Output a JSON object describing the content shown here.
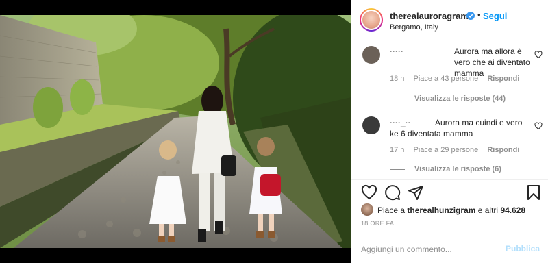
{
  "header": {
    "username": "therealauroragram",
    "follow_label": "Segui",
    "separator": "•",
    "location": "Bergamo, Italy"
  },
  "comments": [
    {
      "username": "·····",
      "text": "Aurora ma allora è vero che ai diventato mamma",
      "time": "18 h",
      "likes": "Piace a 43 persone",
      "reply_label": "Rispondi",
      "view_replies": "Visualizza le risposte (44)"
    },
    {
      "username": "····_··",
      "text": "Aurora ma cuindi e vero ke 6 diventata mamma",
      "time": "17 h",
      "likes": "Piace a 29 persone",
      "reply_label": "Rispondi",
      "view_replies": "Visualizza le risposte (6)"
    }
  ],
  "actions": {
    "icons": [
      "heart-icon",
      "comment-icon",
      "share-icon",
      "bookmark-icon"
    ]
  },
  "likes": {
    "prefix": "Piace a",
    "user": "therealhunzigram",
    "suffix": "e altri",
    "count": "94.628"
  },
  "date": "18 ORE FA",
  "comment_box": {
    "placeholder": "Aggiungi un commento...",
    "publish_label": "Pubblica"
  },
  "colors": {
    "accent": "#0095f6",
    "publish_disabled": "#b2dffc",
    "muted": "#8e8e8e",
    "text": "#262626"
  }
}
